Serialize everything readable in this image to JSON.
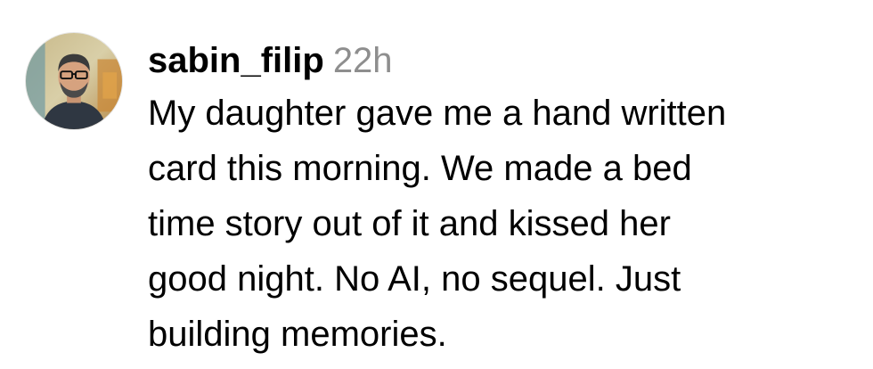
{
  "comment": {
    "username": "sabin_filip",
    "timestamp": "22h",
    "lines": [
      "My daughter gave me a hand written",
      "card this morning. We made a bed",
      "time story out of it and kissed her",
      "good night. No AI, no sequel. Just",
      "building memories."
    ]
  },
  "colors": {
    "username": "#000000",
    "timestamp": "#8e8e8e",
    "text": "#000000",
    "background": "#ffffff"
  }
}
